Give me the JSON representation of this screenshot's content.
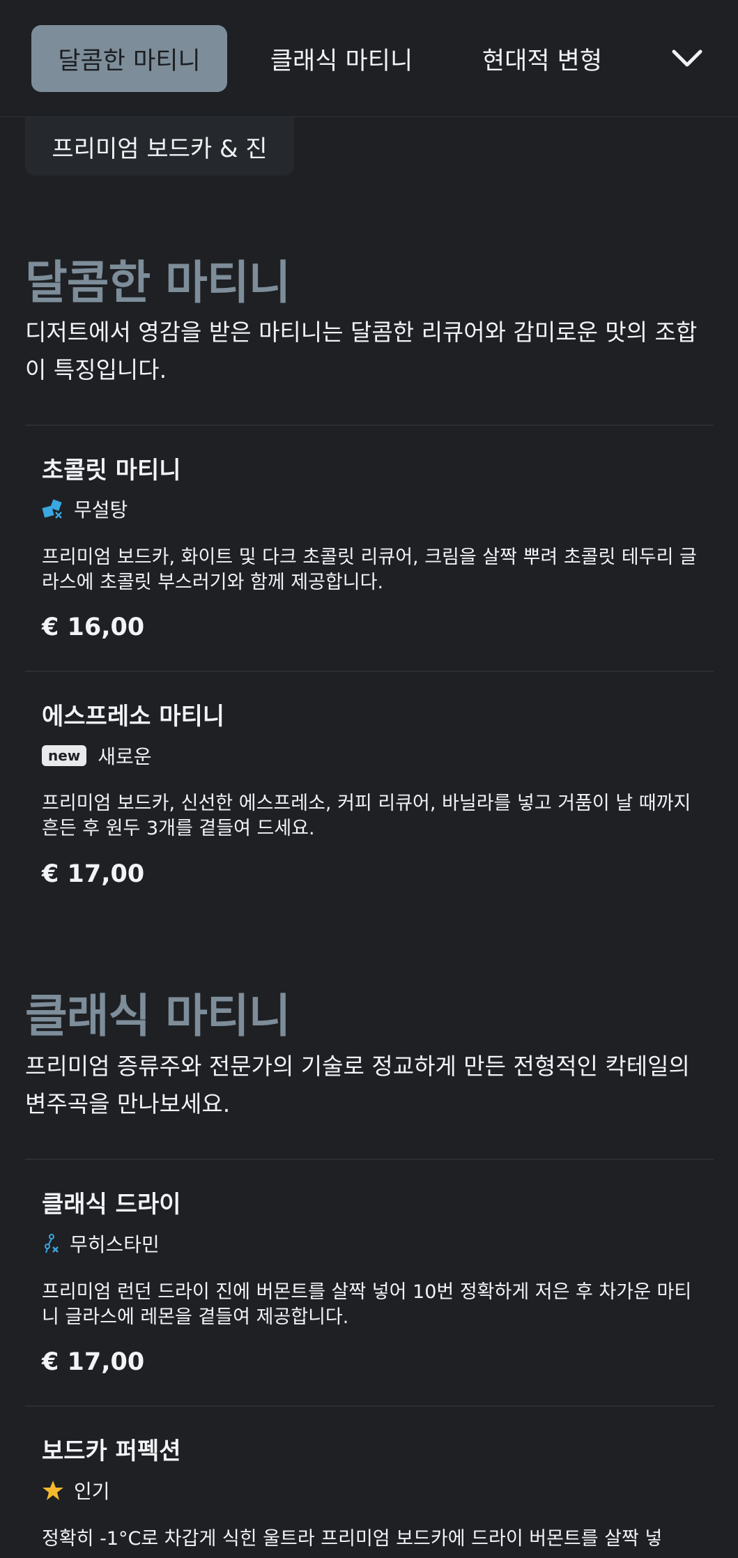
{
  "nav": {
    "tabs": [
      {
        "label": "달콤한 마티니",
        "active": true
      },
      {
        "label": "클래식 마티니",
        "active": false
      },
      {
        "label": "현대적 변형",
        "active": false
      }
    ],
    "more_icon": "chevron-down-icon",
    "subtab": "프리미엄 보드카 & 진"
  },
  "colors": {
    "background": "#1e2024",
    "accent": "#7d8d99",
    "text": "#f2f3f5",
    "star": "#f5b82e",
    "badge_icon": "#3aa7e0"
  },
  "sections": [
    {
      "title": "달콤한 마티니",
      "description": "디저트에서 영감을 받은 마티니는 달콤한 리큐어와 감미로운 맛의 조합이 특징입니다.",
      "items": [
        {
          "name": "초콜릿 마티니",
          "badge_icon": "sugar-free-icon",
          "badge": "무설탕",
          "description": "프리미엄 보드카, 화이트 및 다크 초콜릿 리큐어, 크림을 살짝 뿌려 초콜릿 테두리 글라스에 초콜릿 부스러기와 함께 제공합니다.",
          "price": "€ 16,00"
        },
        {
          "name": "에스프레소 마티니",
          "badge_pill": "new",
          "badge": "새로운",
          "description": "프리미엄 보드카, 신선한 에스프레소, 커피 리큐어, 바닐라를 넣고 거품이 날 때까지 흔든 후 원두 3개를 곁들여 드세요.",
          "price": "€ 17,00"
        }
      ]
    },
    {
      "title": "클래식 마티니",
      "description": "프리미엄 증류주와 전문가의 기술로 정교하게 만든 전형적인 칵테일의 변주곡을 만나보세요.",
      "items": [
        {
          "name": "클래식 드라이",
          "badge_icon": "histamine-free-icon",
          "badge": "무히스타민",
          "description": "프리미엄 런던 드라이 진에 버몬트를 살짝 넣어 10번 정확하게 저은 후 차가운 마티니 글라스에 레몬을 곁들여 제공합니다.",
          "price": "€ 17,00"
        },
        {
          "name": "보드카 퍼펙션",
          "badge_icon": "star-icon",
          "badge": "인기",
          "description": "정확히 -1°C로 차갑게 식힌 울트라 프리미엄 보드카에 드라이 버몬트를 살짝 넣",
          "price": ""
        }
      ]
    }
  ]
}
